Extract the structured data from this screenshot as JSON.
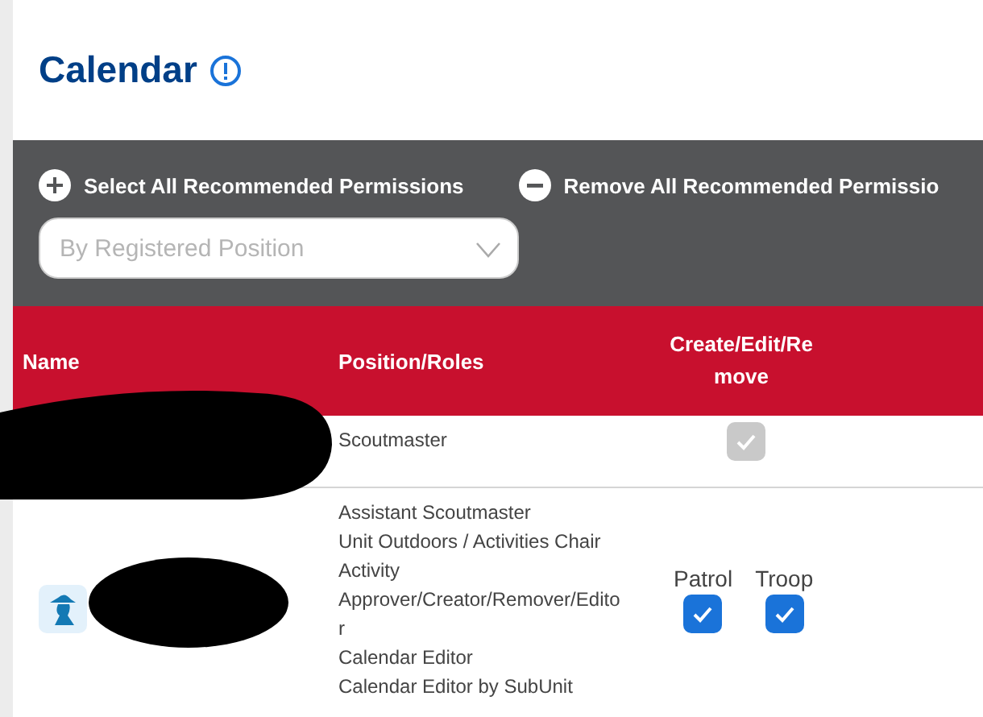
{
  "page": {
    "title": "Calendar"
  },
  "actions": [
    {
      "kind": "add",
      "label": "Select All Recommended Permissions"
    },
    {
      "kind": "remove",
      "label": "Remove All Recommended Permissio"
    }
  ],
  "filter": {
    "placeholder": "By Registered Position"
  },
  "table": {
    "columns": [
      "Name",
      "Position/Roles",
      "Create/Edit/Remove"
    ],
    "rows": [
      {
        "avatar": false,
        "roles": [
          "Scoutmaster"
        ],
        "permissions": [
          {
            "checked": true,
            "disabled": true
          }
        ]
      },
      {
        "avatar": true,
        "roles": [
          "Assistant Scoutmaster",
          "Unit Outdoors / Activities Chair",
          "Activity Approver/Creator/Remover/Editor",
          "Calendar Editor",
          "Calendar Editor by SubUnit"
        ],
        "permissions": [
          {
            "label": "Patrol",
            "checked": true,
            "disabled": false
          },
          {
            "label": "Troop",
            "checked": true,
            "disabled": false
          }
        ]
      }
    ]
  }
}
